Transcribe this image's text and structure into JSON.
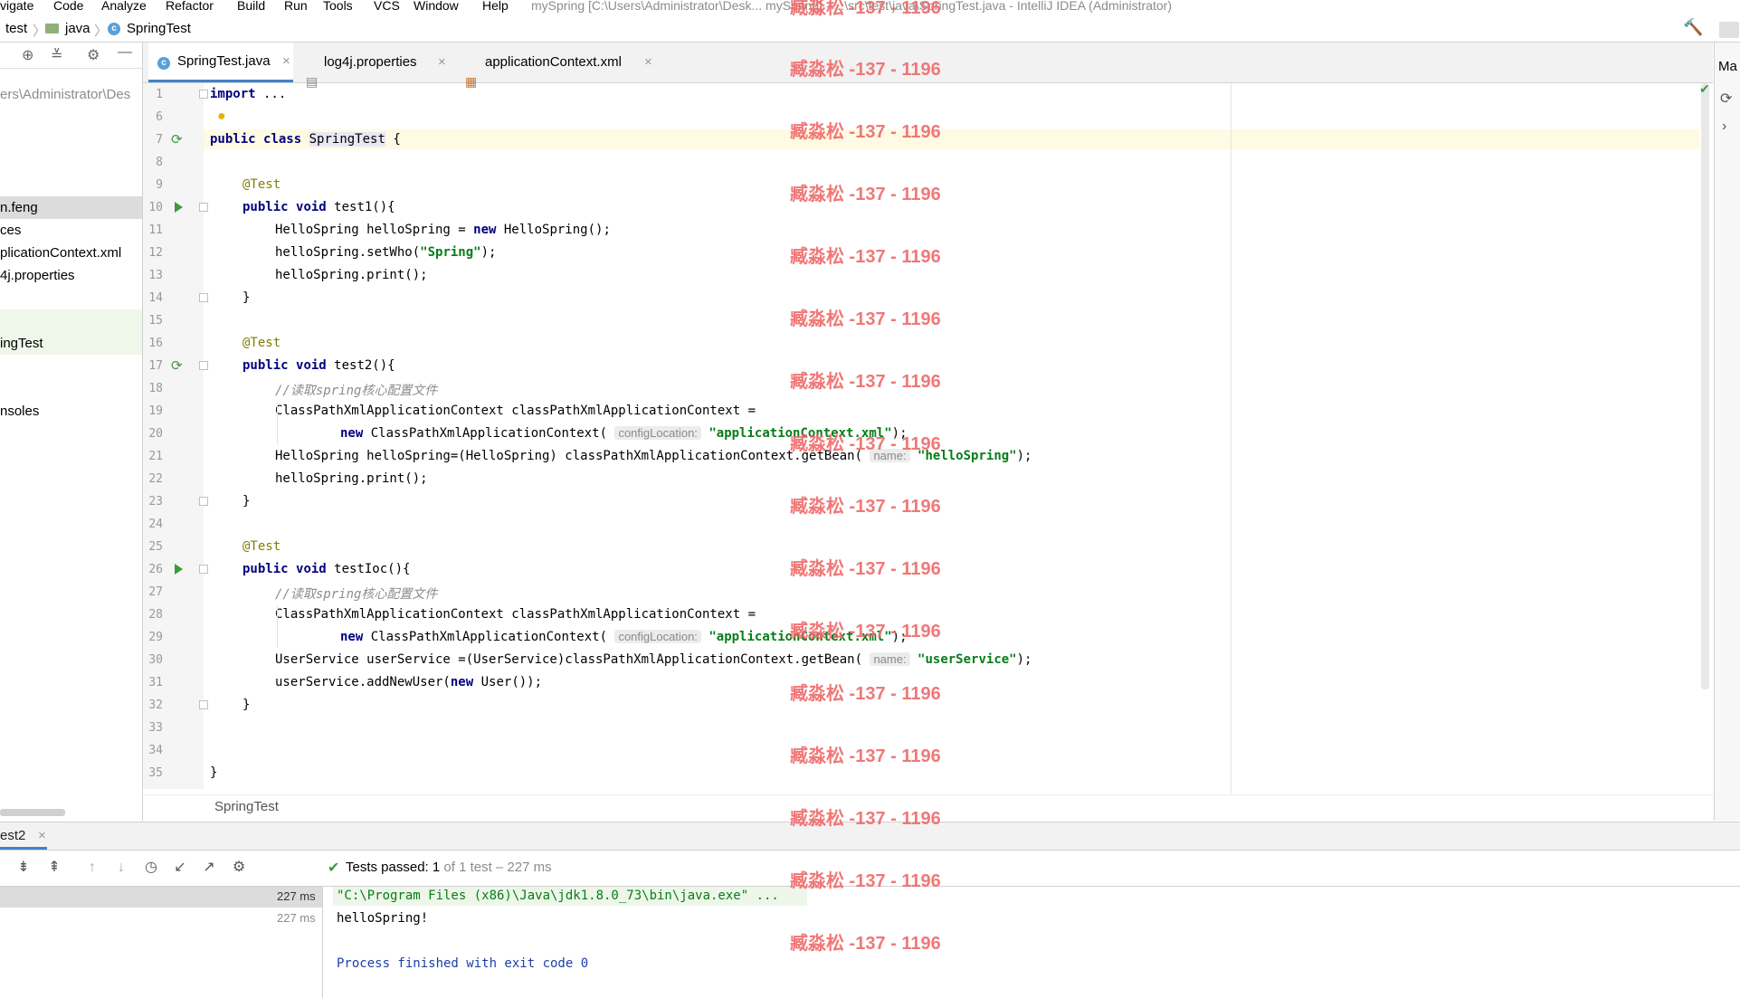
{
  "menu": {
    "items": [
      "vigate",
      "Code",
      "Analyze",
      "Refactor",
      "Build",
      "Run",
      "Tools",
      "VCS",
      "Window",
      "Help"
    ],
    "window_title": "mySpring [C:\\Users\\Administrator\\Desk... mySpring] - ...\\src\\test\\java\\SpringTest.java - IntelliJ IDEA (Administrator)"
  },
  "nav": {
    "crumbs": [
      "test",
      "java",
      "SpringTest"
    ]
  },
  "project": {
    "path": "ers\\Administrator\\Des",
    "items": [
      "n.feng",
      "ces",
      "plicationContext.xml",
      "4j.properties",
      "ingTest",
      "nsoles"
    ]
  },
  "tabs": [
    {
      "label": "SpringTest.java",
      "close": "×"
    },
    {
      "label": "log4j.properties",
      "close": "×"
    },
    {
      "label": "applicationContext.xml",
      "close": "×"
    }
  ],
  "editor": {
    "line_numbers": [
      "1",
      "6",
      "7",
      "8",
      "9",
      "10",
      "11",
      "12",
      "13",
      "14",
      "15",
      "16",
      "17",
      "18",
      "19",
      "20",
      "21",
      "22",
      "23",
      "24",
      "25",
      "26",
      "27",
      "28",
      "29",
      "30",
      "31",
      "32",
      "33",
      "34",
      "35"
    ],
    "kw_import": "import",
    "import_rest": " ...",
    "kw_public": "public",
    "kw_class": "class",
    "kw_void": "void",
    "kw_new": "new",
    "class_name": "SpringTest",
    "brace_open": " {",
    "ann_test": "@Test",
    "m_test1": " test1(){",
    "l11a": "HelloSpring helloSpring = ",
    "l11b": " HelloSpring();",
    "l12a": "helloSpring.setWho(",
    "l12s": "\"Spring\"",
    "l12b": ");",
    "l13": "helloSpring.print();",
    "close_brace": "}",
    "m_test2": " test2(){",
    "comment": "//读取spring核心配置文件",
    "l19": "ClassPathXmlApplicationContext classPathXmlApplicationContext =",
    "l20a": " ClassPathXmlApplicationContext(",
    "hint_config": "configLocation:",
    "s_appctx": "\"applicationContext.xml\"",
    "l20b": ");",
    "l21a": "HelloSpring helloSpring=(HelloSpring) classPathXmlApplicationContext.getBean(",
    "hint_name": "name:",
    "s_hellospring": "\"helloSpring\"",
    "l21b": ");",
    "l22": "helloSpring.print();",
    "m_testioc": " testIoc(){",
    "l30a": "UserService userService =(UserService)classPathXmlApplicationContext.getBean(",
    "s_userservice": "\"userService\"",
    "l30b": ");",
    "l31a": "userService.addNewUser(",
    "l31b": " User());"
  },
  "breadcrumb": {
    "label": "SpringTest"
  },
  "run": {
    "tab_label": "est2",
    "tab_close": "×",
    "status_bold": "Tests passed: ",
    "status_count": "1",
    "status_rest": " of 1 test – 227 ms",
    "time1": "227 ms",
    "time2": "227 ms",
    "console_cmd": "\"C:\\Program Files (x86)\\Java\\jdk1.8.0_73\\bin\\java.exe\" ...",
    "console_out": "helloSpring!",
    "console_exit": "Process finished with exit code 0"
  },
  "right": {
    "label": "Ma"
  },
  "watermark": {
    "text": "臧淼松 -137 - 1196"
  },
  "colors": {
    "accent": "#4083c9",
    "keyword": "#000080",
    "string": "#067d17",
    "annotation": "#808000",
    "watermark": "#ef6a6a",
    "run_green": "#3c9a3c"
  }
}
